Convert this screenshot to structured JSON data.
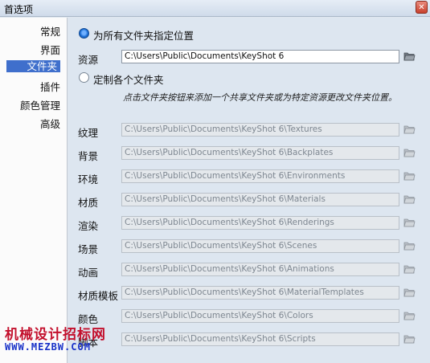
{
  "window": {
    "title": "首选项",
    "close_glyph": "✕"
  },
  "sidebar": {
    "items": [
      {
        "label": "常规",
        "active": false
      },
      {
        "label": "界面",
        "active": false
      },
      {
        "label": "文件夹",
        "active": true
      },
      {
        "label": "插件",
        "active": false
      },
      {
        "label": "颜色管理",
        "active": false
      },
      {
        "label": "高级",
        "active": false
      }
    ]
  },
  "main": {
    "option_all": {
      "label": "为所有文件夹指定位置",
      "selected": true
    },
    "resources": {
      "label": "资源",
      "value": "C:\\Users\\Public\\Documents\\KeyShot 6"
    },
    "option_each": {
      "label": "定制各个文件夹",
      "selected": false
    },
    "instructions": "点击文件夹按钮来添加一个共享文件夹或为特定资源更改文件夹位置。",
    "folders": [
      {
        "label": "纹理",
        "value": "C:\\Users\\Public\\Documents\\KeyShot 6\\Textures"
      },
      {
        "label": "背景",
        "value": "C:\\Users\\Public\\Documents\\KeyShot 6\\Backplates"
      },
      {
        "label": "环境",
        "value": "C:\\Users\\Public\\Documents\\KeyShot 6\\Environments"
      },
      {
        "label": "材质",
        "value": "C:\\Users\\Public\\Documents\\KeyShot 6\\Materials"
      },
      {
        "label": "渲染",
        "value": "C:\\Users\\Public\\Documents\\KeyShot 6\\Renderings"
      },
      {
        "label": "场景",
        "value": "C:\\Users\\Public\\Documents\\KeyShot 6\\Scenes"
      },
      {
        "label": "动画",
        "value": "C:\\Users\\Public\\Documents\\KeyShot 6\\Animations"
      },
      {
        "label": "材质模板",
        "value": "C:\\Users\\Public\\Documents\\KeyShot 6\\MaterialTemplates"
      },
      {
        "label": "颜色",
        "value": "C:\\Users\\Public\\Documents\\KeyShot 6\\Colors"
      },
      {
        "label": "脚本",
        "value": "C:\\Users\\Public\\Documents\\KeyShot 6\\Scripts"
      }
    ]
  },
  "watermark": {
    "title": "机械设计招标网",
    "url": "WWW.MEZBW.COM"
  },
  "icons": {
    "folder": "folder-icon",
    "radio_on": "radio-selected-icon",
    "radio_off": "radio-unselected-icon"
  },
  "colors": {
    "selection": "#3f6fcc",
    "panel": "#dde6f0",
    "watermark_red": "#c3102d",
    "watermark_blue": "#1730c8"
  }
}
